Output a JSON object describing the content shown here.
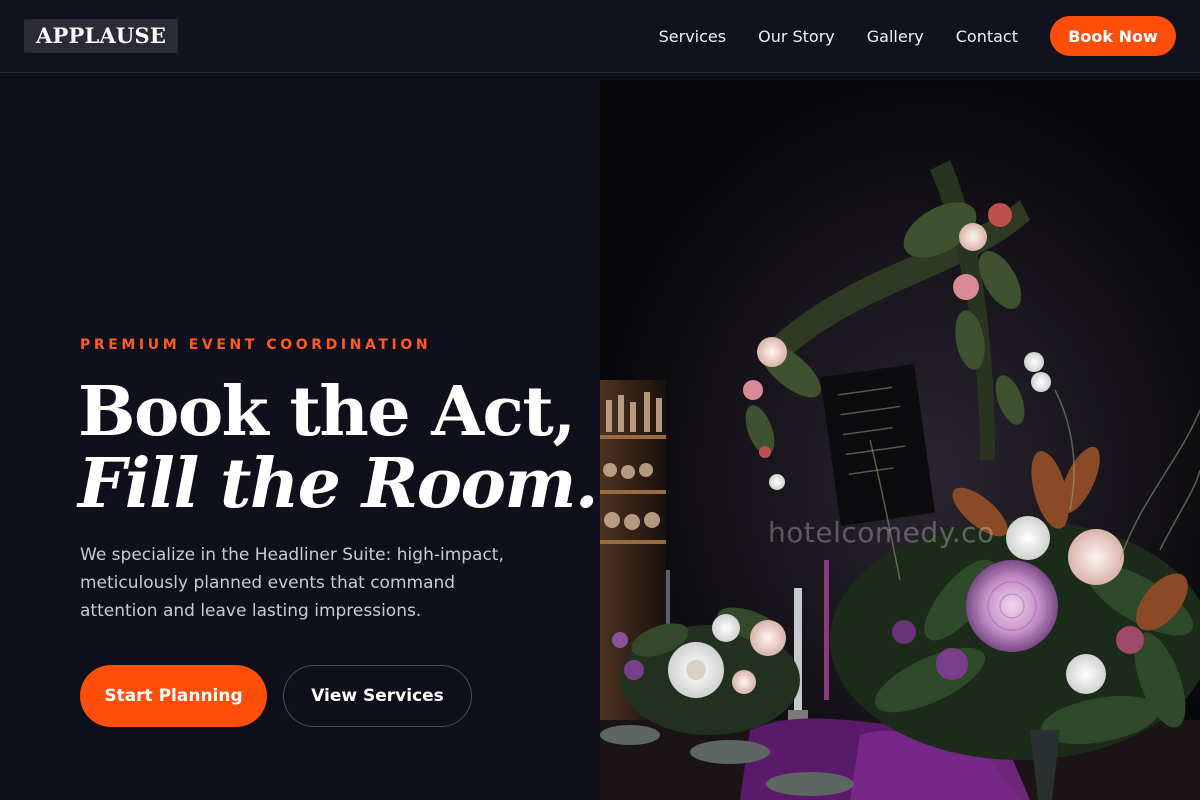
{
  "brand": {
    "logo_text": "APPLAUSE"
  },
  "nav": {
    "links": [
      "Services",
      "Our Story",
      "Gallery",
      "Contact"
    ],
    "cta_label": "Book Now"
  },
  "hero": {
    "eyebrow": "PREMIUM EVENT COORDINATION",
    "headline_line1": "Book the Act,",
    "headline_line2": "Fill the Room.",
    "description": "We specialize in the Headliner Suite: high-impact, meticulously planned events that command attention and leave lasting impressions.",
    "primary_cta": "Start Planning",
    "secondary_cta": "View Services",
    "image": {
      "subject": "dark moody banquet table with floral arrangements and candles",
      "watermark": "hotelcomedy.co"
    }
  },
  "colors": {
    "background": "#10101d",
    "accent": "#ff4d0a",
    "text": "#ffffff",
    "muted_text": "#c9cad6"
  }
}
